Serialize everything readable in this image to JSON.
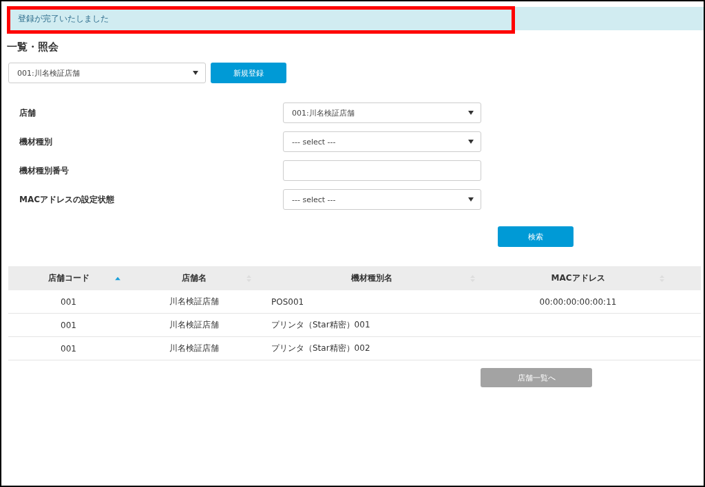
{
  "alert": {
    "message": "登録が完了いたしました",
    "highlighted": true
  },
  "page_title": "一覧・照会",
  "store_select": {
    "value": "001:川名検証店舗"
  },
  "new_button": "新規登録",
  "filters": [
    {
      "kind": "select",
      "label": "店舗",
      "value": "001:川名検証店舗"
    },
    {
      "kind": "select",
      "label": "機材種別",
      "value": "--- select ---"
    },
    {
      "kind": "input",
      "label": "機材種別番号"
    },
    {
      "kind": "select",
      "label": "MACアドレスの設定状態",
      "value": "--- select ---"
    }
  ],
  "search_button": "検索",
  "table": {
    "columns": [
      {
        "label": "店舗コード",
        "sorted": true
      },
      {
        "label": "店舗名",
        "sorted": false
      },
      {
        "label": "機材種別名",
        "sorted": false
      },
      {
        "label": "MACアドレス",
        "sorted": false
      }
    ],
    "rows": [
      [
        "001",
        "川名検証店舗",
        "POS001",
        "00:00:00:00:00:11"
      ],
      [
        "001",
        "川名検証店舗",
        "プリンタ（Star精密）001",
        ""
      ],
      [
        "001",
        "川名検証店舗",
        "プリンタ（Star精密）002",
        ""
      ]
    ]
  },
  "back_button": "店舗一覧へ"
}
